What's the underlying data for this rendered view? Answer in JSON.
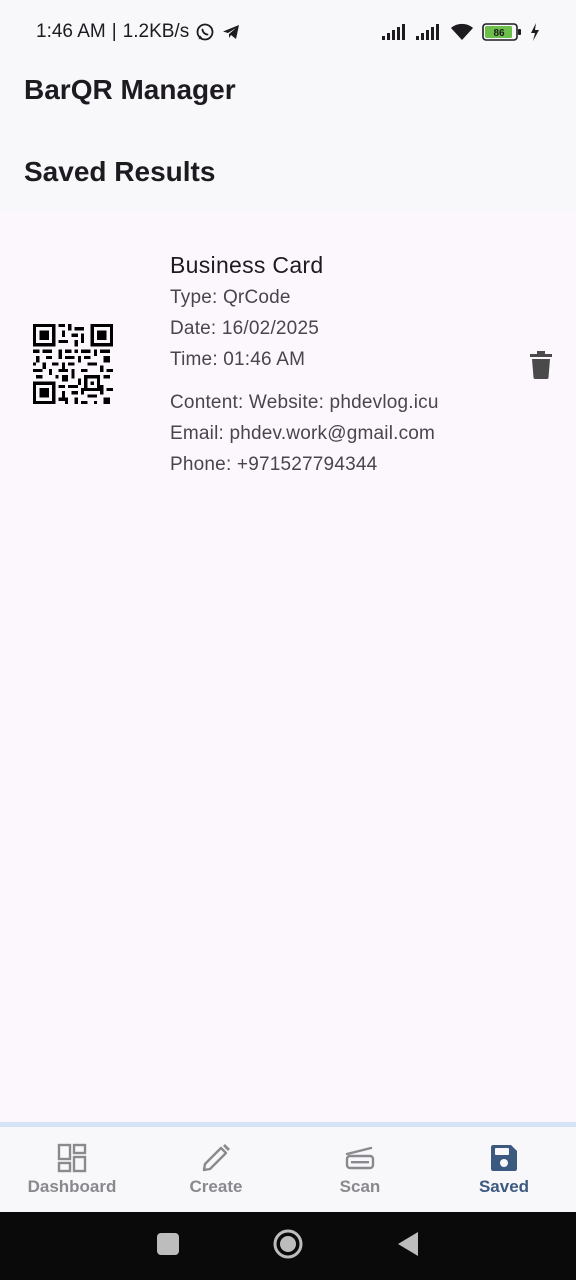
{
  "status_bar": {
    "time": "1:46 AM",
    "network_speed": "1.2KB/s",
    "battery": "86",
    "icons": [
      "whatsapp-icon",
      "telegram-icon",
      "signal-icon",
      "signal-icon",
      "wifi-icon",
      "battery-icon",
      "charging-icon"
    ]
  },
  "app": {
    "title": "BarQR Manager",
    "section_title": "Saved Results"
  },
  "results": [
    {
      "title": "Business Card",
      "type": "Type: QrCode",
      "date": "Date: 16/02/2025",
      "time": "Time: 01:46 AM",
      "content": "Content: Website: phdevlog.icu",
      "email": "Email: phdev.work@gmail.com",
      "phone": "Phone: +971527794344",
      "icon": "qr-code-icon",
      "action_icon": "delete-icon"
    }
  ],
  "bottom_nav": {
    "items": [
      {
        "label": "Dashboard",
        "icon": "dashboard-icon",
        "active": false
      },
      {
        "label": "Create",
        "icon": "pencil-icon",
        "active": false
      },
      {
        "label": "Scan",
        "icon": "scanner-icon",
        "active": false
      },
      {
        "label": "Saved",
        "icon": "save-icon",
        "active": true
      }
    ]
  },
  "colors": {
    "background": "#fcf7fd",
    "active_nav": "#3c5a80",
    "inactive_nav": "#8a8a8e",
    "nav_border": "#d6e2f6",
    "battery_fill": "#6cc04a"
  },
  "system_nav": {
    "icons": [
      "recents-icon",
      "home-icon",
      "back-icon"
    ]
  }
}
